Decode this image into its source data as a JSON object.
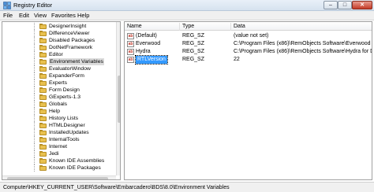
{
  "window": {
    "title": "Registry Editor",
    "minimize_glyph": "–",
    "maximize_glyph": "□",
    "close_glyph": "✕"
  },
  "menu": [
    "File",
    "Edit",
    "View",
    "Favorites",
    "Help"
  ],
  "tree": {
    "items": [
      {
        "label": "DesignerInsight"
      },
      {
        "label": "DifferenceViewer"
      },
      {
        "label": "Disabled Packages"
      },
      {
        "label": "DotNetFramework"
      },
      {
        "label": "Editor"
      },
      {
        "label": "Environment Variables",
        "selected": true
      },
      {
        "label": "EvaluatorWindow"
      },
      {
        "label": "ExpanderForm"
      },
      {
        "label": "Experts"
      },
      {
        "label": "Form Design"
      },
      {
        "label": "GExperts-1.3"
      },
      {
        "label": "Globals"
      },
      {
        "label": "Help"
      },
      {
        "label": "History Lists"
      },
      {
        "label": "HTMLDesigner"
      },
      {
        "label": "InstalledUpdates"
      },
      {
        "label": "InternalTools"
      },
      {
        "label": "Internet"
      },
      {
        "label": "Jedi"
      },
      {
        "label": "Known IDE Assemblies"
      },
      {
        "label": "Known IDE Packages"
      }
    ]
  },
  "list": {
    "columns": {
      "name": "Name",
      "type": "Type",
      "data": "Data"
    },
    "value_icon_text": "ab",
    "rows": [
      {
        "name": "(Default)",
        "type": "REG_SZ",
        "data": "(value not set)"
      },
      {
        "name": "Everwood",
        "type": "REG_SZ",
        "data": "C:\\Program Files (x86)\\RemObjects Software\\Everwood"
      },
      {
        "name": "Hydra",
        "type": "REG_SZ",
        "data": "C:\\Program Files (x86)\\RemObjects Software\\Hydra for Delphi"
      },
      {
        "name": "RTLVersion",
        "type": "REG_SZ",
        "data": "22",
        "selected": true
      }
    ]
  },
  "status": {
    "path": "Computer\\HKEY_CURRENT_USER\\Software\\Embarcadero\\BDS\\8.0\\Environment Variables"
  }
}
